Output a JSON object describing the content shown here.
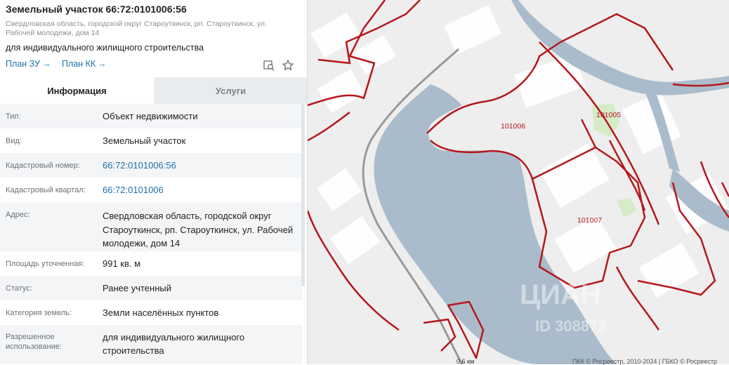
{
  "header": {
    "title": "Земельный участок 66:72:0101006:56",
    "address_small": "Свердловская область, городской округ Староуткинск, рп. Староуткинск, ул. Рабочей молодежи, дом 14",
    "purpose": "для индивидуального жилищного строительства",
    "plan_zu": "План ЗУ",
    "plan_kk": "План КК",
    "arrow": "→",
    "icons": [
      "search-map-icon",
      "star-icon"
    ]
  },
  "tabs": [
    {
      "label": "Информация",
      "active": true
    },
    {
      "label": "Услуги",
      "active": false
    }
  ],
  "info": {
    "type_label": "Тип:",
    "type_value": "Объект недвижимости",
    "kind_label": "Вид:",
    "kind_value": "Земельный участок",
    "cad_num_label": "Кадастровый номер:",
    "cad_num_value": "66:72:0101006:56",
    "cad_quarter_label": "Кадастровый квартал:",
    "cad_quarter_value": "66:72:0101006",
    "address_label": "Адрес:",
    "address_value": "Свердловская область, городской округ Староуткинск, рп. Староуткинск, ул. Рабочей молодежи, дом 14",
    "area_label": "Площадь уточненная:",
    "area_value": "991 кв. м",
    "status_label": "Статус:",
    "status_value": "Ранее учтенный",
    "category_label": "Категория земель:",
    "category_value": "Земли населённых пунктов",
    "permitted_label": "Разрешенное использование:",
    "permitted_value": "для индивидуального жилищного строительства"
  },
  "map": {
    "labels": [
      "101006",
      "101005",
      "101007"
    ],
    "watermark": "ЦИАН",
    "watermark_id": "ID 308873",
    "scale": "0.6 км",
    "copyright": "ПКК © Росреестр, 2010-2024 | ГБКО © Росреестр"
  },
  "colors": {
    "link": "#1f6fa8",
    "boundary": "#b5171c",
    "water": "#aabccb"
  }
}
